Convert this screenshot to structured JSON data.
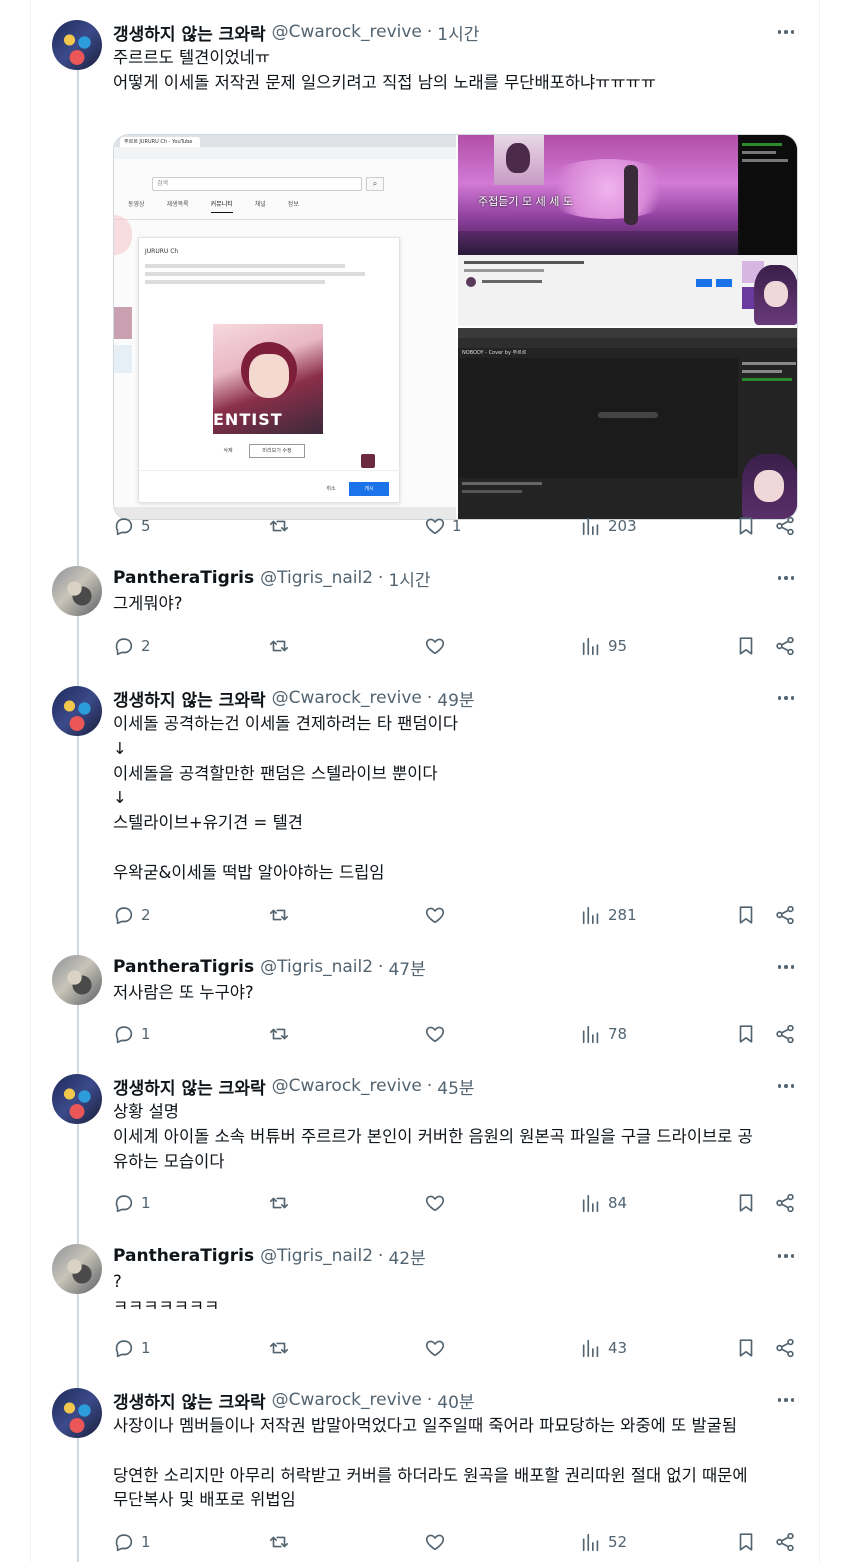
{
  "tweets": [
    {
      "author": "갱생하지 않는 크와락",
      "handle": "@Cwarock_revive",
      "time": "1시간",
      "avatar_icon": "mech-avatar",
      "lines": [
        "주르르도 텔견이었네ㅠ",
        "어떻게 이세돌 저작권 문제 일으키려고 직접 남의 노래를 무단배포하냐ㅠㅠㅠㅠ"
      ],
      "replies": "5",
      "retweets": "",
      "likes": "1",
      "views": "203",
      "media": {
        "left": {
          "browser_tab": "주르르 JURURU Ch - YouTube",
          "search_placeholder": "검색",
          "channel_tabs": [
            "동영상",
            "재생목록",
            "커뮤니티",
            "채널",
            "정보"
          ],
          "channel_name": "JURURU Ch",
          "album_text": "ENTIST",
          "btn_delete": "삭제",
          "btn_preview": "미리보기 수정",
          "btn_cancel": "취소",
          "btn_post": "게시"
        },
        "top_right": {
          "overlay_text": "주접듣기 모 세 세 도"
        },
        "bottom_right": {
          "video_title": "NOBODY - Cover by 주르르"
        }
      }
    },
    {
      "author": "PantheraTigris",
      "handle": "@Tigris_nail2",
      "time": "1시간",
      "avatar_icon": "tiger-avatar",
      "lines": [
        "그게뭐야?"
      ],
      "replies": "2",
      "retweets": "",
      "likes": "",
      "views": "95"
    },
    {
      "author": "갱생하지 않는 크와락",
      "handle": "@Cwarock_revive",
      "time": "49분",
      "avatar_icon": "mech-avatar",
      "lines": [
        "이세돌 공격하는건 이세돌 견제하려는 타 팬덤이다",
        "↓",
        "이세돌을 공격할만한 팬덤은 스텔라이브 뿐이다",
        "↓",
        "스텔라이브+유기견 = 텔견",
        "",
        "우왁굳&이세돌 떡밥 알아야하는 드립임"
      ],
      "replies": "2",
      "retweets": "",
      "likes": "",
      "views": "281"
    },
    {
      "author": "PantheraTigris",
      "handle": "@Tigris_nail2",
      "time": "47분",
      "avatar_icon": "tiger-avatar",
      "lines": [
        "저사람은 또 누구야?"
      ],
      "replies": "1",
      "retweets": "",
      "likes": "",
      "views": "78"
    },
    {
      "author": "갱생하지 않는 크와락",
      "handle": "@Cwarock_revive",
      "time": "45분",
      "avatar_icon": "mech-avatar",
      "lines": [
        "상황 설명",
        "이세계 아이돌 소속 버튜버 주르르가 본인이 커버한 음원의 원본곡 파일을 구글 드라이브로 공",
        "유하는 모습이다"
      ],
      "replies": "1",
      "retweets": "",
      "likes": "",
      "views": "84"
    },
    {
      "author": "PantheraTigris",
      "handle": "@Tigris_nail2",
      "time": "42분",
      "avatar_icon": "tiger-avatar",
      "lines": [
        "?",
        "ㅋㅋㅋㅋㅋㅋㅋ"
      ],
      "replies": "1",
      "retweets": "",
      "likes": "",
      "views": "43"
    },
    {
      "author": "갱생하지 않는 크와락",
      "handle": "@Cwarock_revive",
      "time": "40분",
      "avatar_icon": "mech-avatar",
      "lines": [
        "사장이나 멤버들이나 저작권 밥말아먹었다고 일주일때 죽어라 파묘당하는 와중에 또 발굴됨",
        "",
        "당연한 소리지만 아무리 허락받고 커버를 하더라도 원곡을 배포할 권리따윈 절대 없기 때문에",
        "무단복사 및 배포로 위법임"
      ],
      "replies": "1",
      "retweets": "",
      "likes": "",
      "views": "52"
    }
  ],
  "icons": {
    "reply": "speech-bubble-icon",
    "retweet": "retweet-icon",
    "like": "heart-icon",
    "views": "bar-chart-icon",
    "bookmark": "bookmark-icon",
    "share": "share-icon",
    "more": "more-dots-icon"
  },
  "colors": {
    "text": "#0f1419",
    "secondary": "#536471",
    "border": "#cfd9de",
    "link_blue": "#1d9bf0"
  }
}
